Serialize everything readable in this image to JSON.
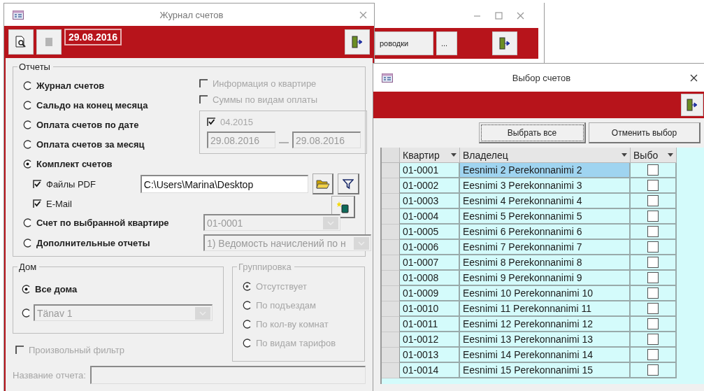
{
  "back_window": {
    "toolbar_buttons": [
      {
        "label": "роводки"
      },
      {
        "label": "..."
      }
    ]
  },
  "journal": {
    "title": "Журнал счетов",
    "date": "29.08.2016",
    "reports": {
      "title": "Отчеты",
      "options": [
        {
          "label": "Журнал счетов",
          "selected": false
        },
        {
          "label": "Сальдо на конец месяца",
          "selected": false
        },
        {
          "label": "Оплата счетов по дате",
          "selected": false
        },
        {
          "label": "Оплата счетов за месяц",
          "selected": false
        },
        {
          "label": "Комплект счетов",
          "selected": true
        }
      ],
      "info_checks": [
        {
          "label": "Информация о квартире",
          "checked": false,
          "disabled": true
        },
        {
          "label": "Суммы по видам оплаты",
          "checked": false,
          "disabled": true
        }
      ],
      "period": {
        "label": "04.2015",
        "checked": true,
        "disabled": true,
        "from": "29.08.2016",
        "to": "29.08.2016"
      },
      "pdf": {
        "label": "Файлы PDF",
        "checked": true,
        "path": "C:\\Users\\Marina\\Desktop"
      },
      "email": {
        "label": "E-Mail",
        "checked": true
      },
      "apartment": {
        "label": "Счет по выбранной квартире",
        "selected": false,
        "value": "01-0001"
      },
      "extra": {
        "label": "Дополнительные отчеты",
        "selected": false,
        "value": "1) Ведомость начислений по н"
      }
    },
    "house": {
      "title": "Дом",
      "options": [
        {
          "label": "Все дома",
          "selected": true
        },
        {
          "selected": false
        }
      ],
      "street": "Tänav 1"
    },
    "grouping": {
      "title": "Группировка",
      "disabled": true,
      "options": [
        {
          "label": "Отсутствует",
          "selected": true
        },
        {
          "label": "По подъездам",
          "selected": false
        },
        {
          "label": "По кол-ву комнат",
          "selected": false
        },
        {
          "label": "По видам тарифов",
          "selected": false
        }
      ]
    },
    "custom_filter": {
      "label": "Произвольный фильтр",
      "checked": false,
      "disabled": true
    },
    "report_name": {
      "label": "Название отчета:"
    }
  },
  "selection": {
    "title": "Выбор счетов",
    "buttons": [
      "Выбрать все",
      "Отменить выбор"
    ],
    "columns": [
      "Квартир",
      "Владелец",
      "Выбо"
    ],
    "rows": [
      {
        "apartment": "01-0001",
        "owner": "Eesnimi 2 Perekonnanimi 2",
        "checked": false,
        "selected": true
      },
      {
        "apartment": "01-0002",
        "owner": "Eesnimi 3 Perekonnanimi 3",
        "checked": false,
        "selected": false
      },
      {
        "apartment": "01-0003",
        "owner": "Eesnimi 4 Perekonnanimi 4",
        "checked": false,
        "selected": false
      },
      {
        "apartment": "01-0004",
        "owner": "Eesnimi 5 Perekonnanimi 5",
        "checked": false,
        "selected": false
      },
      {
        "apartment": "01-0005",
        "owner": "Eesnimi 6 Perekonnanimi 6",
        "checked": false,
        "selected": false
      },
      {
        "apartment": "01-0006",
        "owner": "Eesnimi 7 Perekonnanimi 7",
        "checked": false,
        "selected": false
      },
      {
        "apartment": "01-0007",
        "owner": "Eesnimi 8 Perekonnanimi 8",
        "checked": false,
        "selected": false
      },
      {
        "apartment": "01-0008",
        "owner": "Eesnimi 9 Perekonnanimi 9",
        "checked": false,
        "selected": false
      },
      {
        "apartment": "01-0009",
        "owner": "Eesnimi 10 Perekonnanimi 10",
        "checked": false,
        "selected": false
      },
      {
        "apartment": "01-0010",
        "owner": "Eesnimi 11 Perekonnanimi 11",
        "checked": false,
        "selected": false
      },
      {
        "apartment": "01-0011",
        "owner": "Eesnimi 12 Perekonnanimi 12",
        "checked": false,
        "selected": false
      },
      {
        "apartment": "01-0012",
        "owner": "Eesnimi 13 Perekonnanimi 13",
        "checked": false,
        "selected": false
      },
      {
        "apartment": "01-0013",
        "owner": "Eesnimi 14 Perekonnanimi 14",
        "checked": false,
        "selected": false
      },
      {
        "apartment": "01-0014",
        "owner": "Eesnimi 15 Perekonnanimi 15",
        "checked": false,
        "selected": false
      }
    ]
  }
}
